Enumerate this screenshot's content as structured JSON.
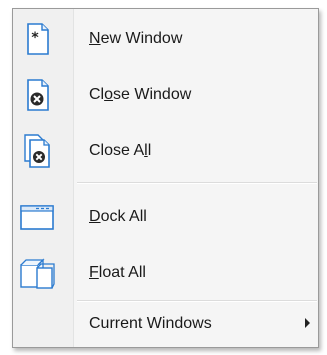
{
  "menu": {
    "items": [
      {
        "pre": "",
        "ul": "N",
        "post": "ew Window",
        "icon": "new-window-icon"
      },
      {
        "pre": "Cl",
        "ul": "o",
        "post": "se Window",
        "icon": "close-window-icon"
      },
      {
        "pre": "Close A",
        "ul": "l",
        "post": "l",
        "icon": "close-all-icon"
      },
      {
        "pre": "",
        "ul": "D",
        "post": "ock All",
        "icon": "dock-all-icon"
      },
      {
        "pre": "",
        "ul": "F",
        "post": "loat All",
        "icon": "float-all-icon"
      },
      {
        "label": "Current Windows",
        "has_submenu": true
      }
    ]
  },
  "colors": {
    "icon_blue": "#2b7bd0",
    "icon_fill": "#ffffff",
    "menu_bg": "#f5f5f5",
    "separator": "#dcdcdc"
  }
}
